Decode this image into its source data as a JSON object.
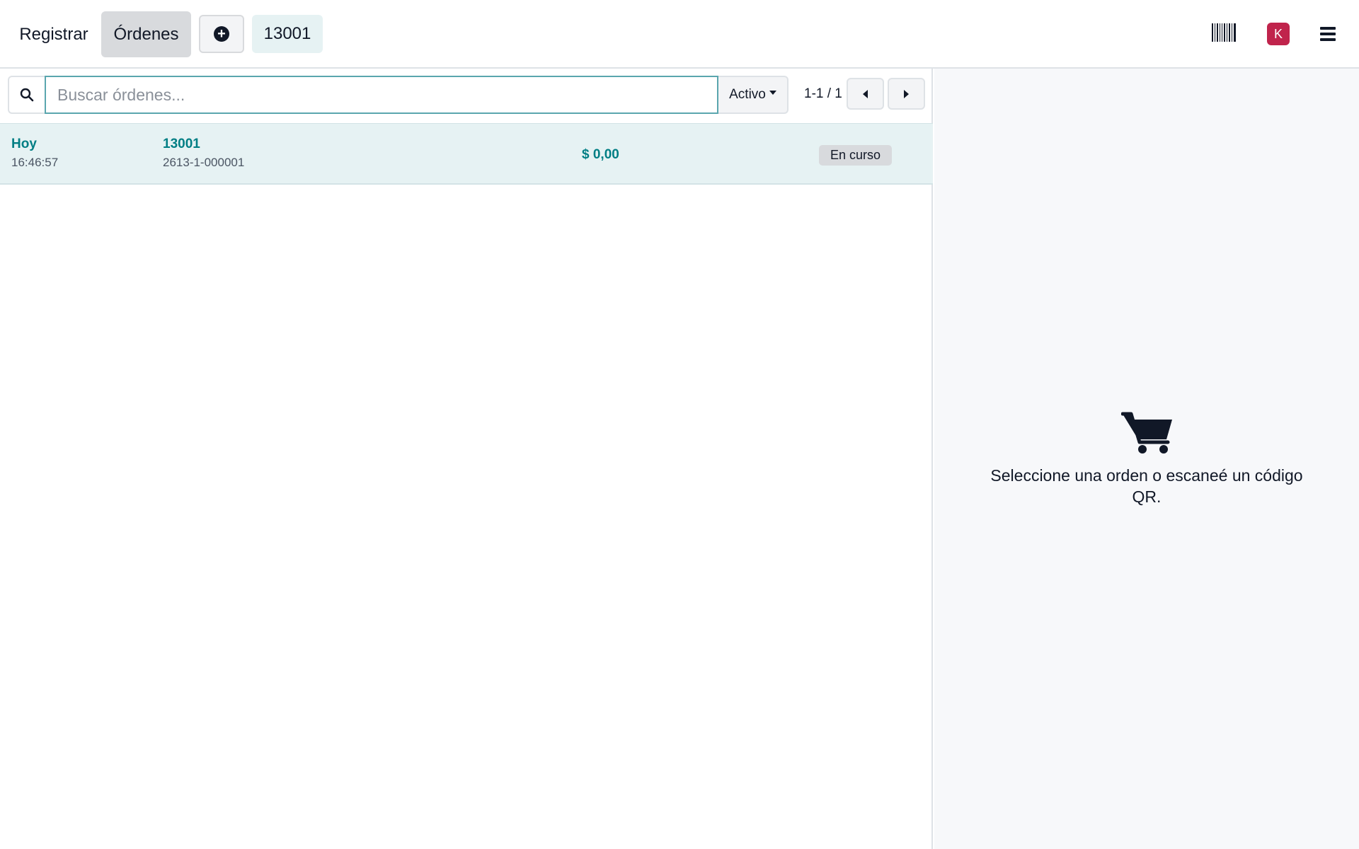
{
  "topbar": {
    "register_label": "Registrar",
    "orders_label": "Órdenes",
    "new_order_icon": "plus-circle-icon",
    "active_order_tab": "13001",
    "barcode_icon": "barcode-icon",
    "avatar_initial": "K",
    "avatar_color": "#c0244c",
    "menu_icon": "hamburger-menu-icon"
  },
  "search": {
    "placeholder": "Buscar órdenes...",
    "value": "",
    "filter_label": "Activo",
    "pager_text": "1-1 / 1"
  },
  "orders": [
    {
      "date": "Hoy",
      "time": "16:46:57",
      "name": "13001",
      "reference": "2613-1-000001",
      "amount": "$ 0,00",
      "status": "En curso"
    }
  ],
  "empty_state": {
    "icon": "shopping-cart-icon",
    "message": "Seleccione una orden o escaneé un código QR."
  },
  "colors": {
    "accent": "#017e84",
    "selected_row": "#e6f2f3",
    "right_panel_bg": "#f7f8fa"
  }
}
